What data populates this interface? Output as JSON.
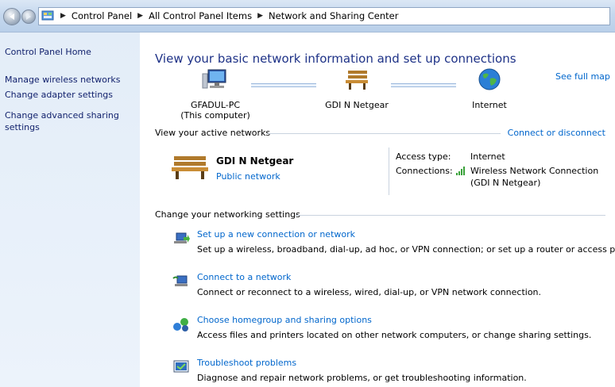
{
  "breadcrumb": {
    "items": [
      "Control Panel",
      "All Control Panel Items",
      "Network and Sharing Center"
    ]
  },
  "sidebar": {
    "home": "Control Panel Home",
    "links": [
      "Manage wireless networks",
      "Change adapter settings",
      "Change advanced sharing settings"
    ]
  },
  "main": {
    "title": "View your basic network information and set up connections",
    "see_full_map": "See full map",
    "map": {
      "computer_name": "GFADUL-PC",
      "computer_sub": "(This computer)",
      "network_name": "GDI N Netgear",
      "internet": "Internet"
    },
    "active_header": "View your active networks",
    "connect_disconnect": "Connect or disconnect",
    "active_network": {
      "name": "GDI N Netgear",
      "type": "Public network",
      "access_type_label": "Access type:",
      "access_type_value": "Internet",
      "connections_label": "Connections:",
      "connection_line1": "Wireless Network Connection",
      "connection_line2": "(GDI N Netgear)"
    },
    "change_header": "Change your networking settings",
    "tasks": [
      {
        "link": "Set up a new connection or network",
        "desc": "Set up a wireless, broadband, dial-up, ad hoc, or VPN connection; or set up a router or access point."
      },
      {
        "link": "Connect to a network",
        "desc": "Connect or reconnect to a wireless, wired, dial-up, or VPN network connection."
      },
      {
        "link": "Choose homegroup and sharing options",
        "desc": "Access files and printers located on other network computers, or change sharing settings."
      },
      {
        "link": "Troubleshoot problems",
        "desc": "Diagnose and repair network problems, or get troubleshooting information."
      }
    ]
  },
  "icons": {
    "back": "back-arrow-icon",
    "forward": "forward-arrow-icon",
    "control_panel": "control-panel-icon",
    "computer": "computer-icon",
    "bench": "bench-icon",
    "globe": "globe-icon",
    "signal": "signal-bars-icon",
    "task_new_connection": "new-connection-icon",
    "task_connect": "connect-network-icon",
    "task_homegroup": "homegroup-icon",
    "task_troubleshoot": "troubleshoot-icon"
  },
  "colors": {
    "link": "#0066cc",
    "title": "#1e3287",
    "sidebar_link": "#0f1f6b",
    "sidebar_bg": "#e3edf8"
  }
}
